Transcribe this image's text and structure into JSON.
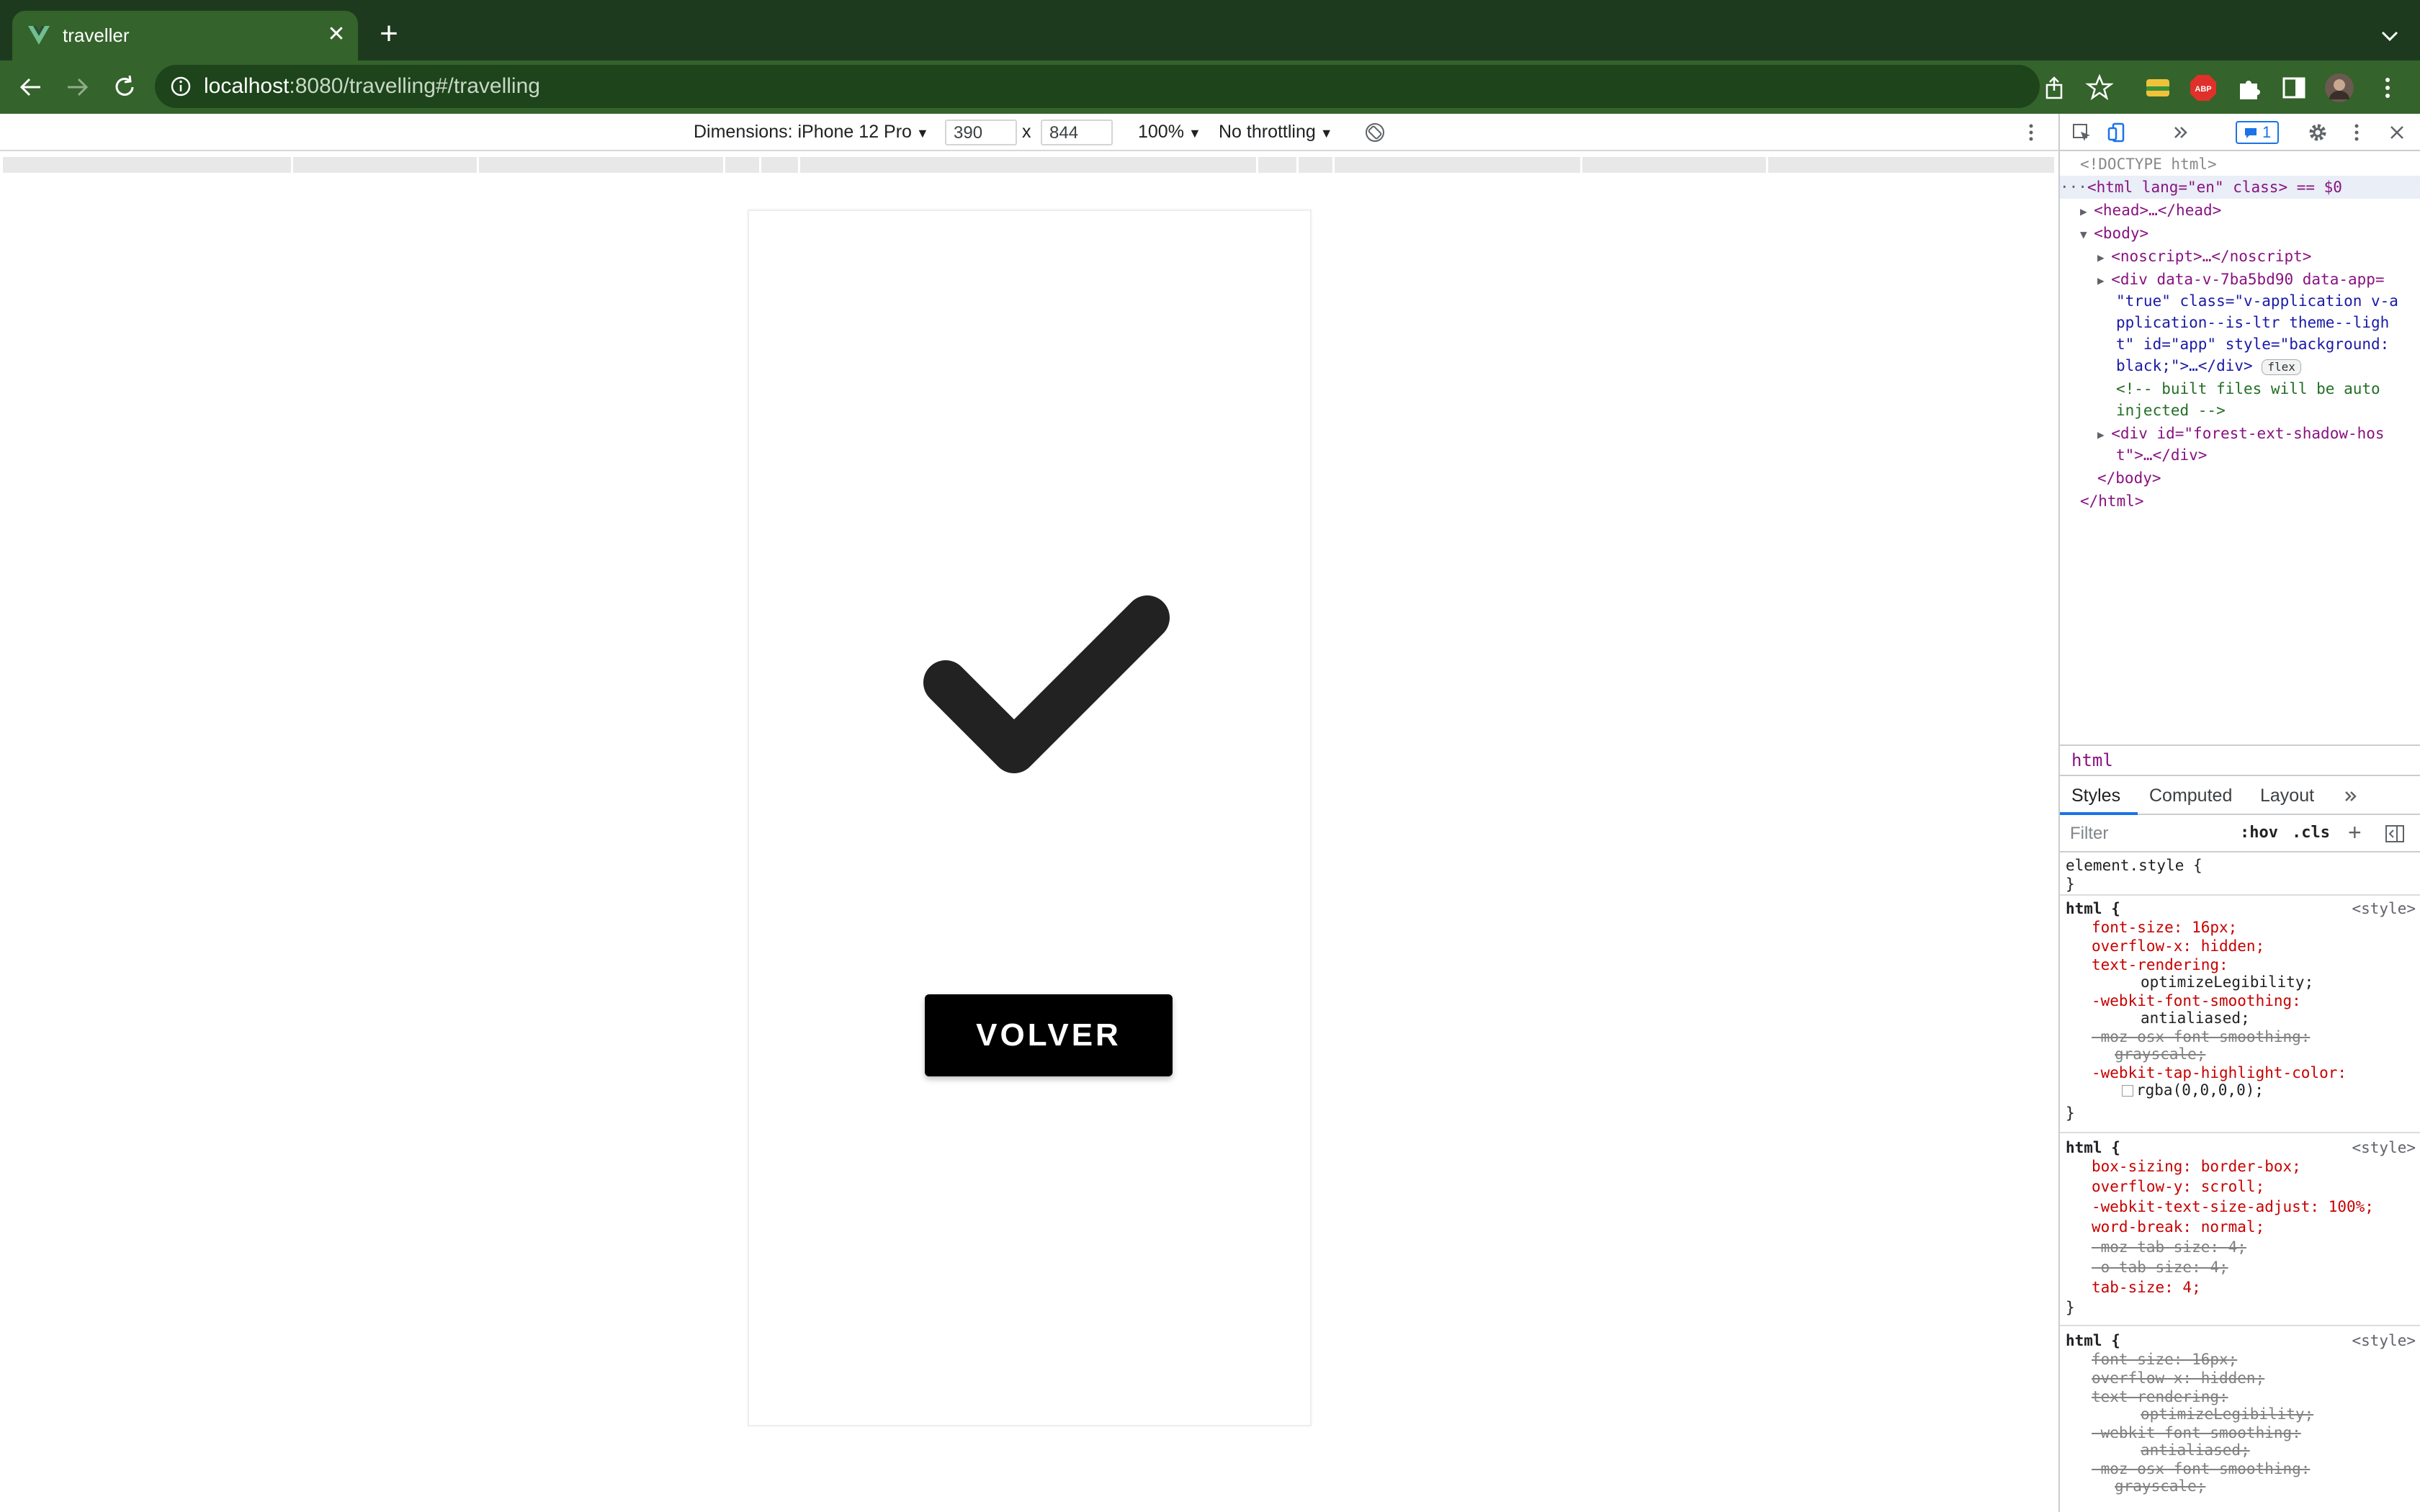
{
  "browser": {
    "tab_title": "traveller",
    "url_host": "localhost",
    "url_rest": ":8080/travelling#/travelling"
  },
  "device_toolbar": {
    "dimensions_label": "Dimensions: iPhone 12 Pro",
    "width": "390",
    "times": "x",
    "height": "844",
    "zoom": "100%",
    "throttling": "No throttling"
  },
  "page": {
    "button_label": "VOLVER",
    "check_color": "#222222"
  },
  "devtools": {
    "badge_count": "1",
    "dom": {
      "doctype": "<!DOCTYPE html>",
      "html_line": "<html lang=\"en\" class> == $0",
      "head_line": "<head>…</head>",
      "body_open": "<body>",
      "noscript": "<noscript>…</noscript>",
      "div_app_1": "<div data-v-7ba5bd90 data-app=",
      "div_app_2": "\"true\" class=\"v-application v-a",
      "div_app_3": "pplication--is-ltr theme--ligh",
      "div_app_4": "t\" id=\"app\" style=\"background:",
      "div_app_5": "black;\">…</div>",
      "flex_pill": "flex",
      "comment_1": "<!-- built files will be auto",
      "comment_2": "injected -->",
      "forest_1": "<div id=\"forest-ext-shadow-hos",
      "forest_2": "t\">…</div>",
      "body_close": "</body>",
      "html_close": "</html>"
    },
    "breadcrumb": "html",
    "subtabs": [
      "Styles",
      "Computed",
      "Layout"
    ],
    "filter_placeholder": "Filter",
    "hov": ":hov",
    "cls": ".cls",
    "styles": {
      "element_style": "element.style {",
      "close_brace": "}",
      "html_open": "html {",
      "source": "<style>",
      "rule1": [
        "font-size: 16px;",
        "overflow-x: hidden;",
        "text-rendering:",
        "optimizeLegibility;",
        "-webkit-font-smoothing:",
        "antialiased;",
        "-moz-osx-font-smoothing:",
        "grayscale;",
        "-webkit-tap-highlight-color:",
        "rgba(0,0,0,0);"
      ],
      "rule2": [
        "box-sizing: border-box;",
        "overflow-y: scroll;",
        "-webkit-text-size-adjust: 100%;",
        "word-break: normal;",
        "-moz-tab-size: 4;",
        "-o-tab-size: 4;",
        "tab-size: 4;"
      ],
      "rule3": [
        "font-size: 16px;",
        "overflow-x: hidden;",
        "text-rendering:",
        "optimizeLegibility;",
        "-webkit-font-smoothing:",
        "antialiased;",
        "-moz-osx-font-smoothing:",
        "grayscale;"
      ]
    }
  }
}
